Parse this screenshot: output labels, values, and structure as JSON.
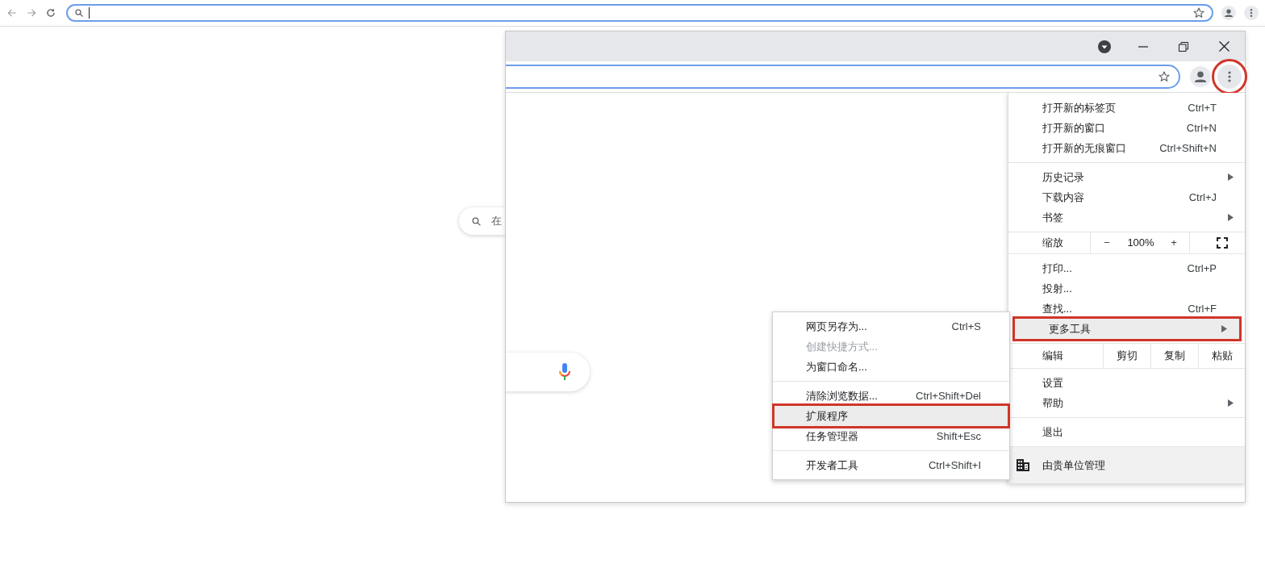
{
  "outer_toolbar": {
    "address_focused": true
  },
  "page_search": {
    "visible_text": "在"
  },
  "inner_window": {
    "menu_button": {
      "highlighted": true
    },
    "menu": {
      "sections": [
        [
          {
            "kind": "item",
            "label": "打开新的标签页",
            "shortcut": "Ctrl+T",
            "highlighted": false
          },
          {
            "kind": "item",
            "label": "打开新的窗口",
            "shortcut": "Ctrl+N",
            "highlighted": false
          },
          {
            "kind": "item",
            "label": "打开新的无痕窗口",
            "shortcut": "Ctrl+Shift+N",
            "highlighted": false
          }
        ],
        [
          {
            "kind": "item",
            "label": "历史记录",
            "has_submenu": true,
            "highlighted": false
          },
          {
            "kind": "item",
            "label": "下载内容",
            "shortcut": "Ctrl+J",
            "highlighted": false
          },
          {
            "kind": "item",
            "label": "书签",
            "has_submenu": true,
            "highlighted": false
          }
        ],
        [
          {
            "kind": "zoom",
            "label": "缩放",
            "minus": "−",
            "value": "100%",
            "plus": "+"
          }
        ],
        [
          {
            "kind": "item",
            "label": "打印...",
            "shortcut": "Ctrl+P",
            "highlighted": false
          },
          {
            "kind": "item",
            "label": "投射...",
            "highlighted": false
          },
          {
            "kind": "item",
            "label": "查找...",
            "shortcut": "Ctrl+F",
            "highlighted": false
          },
          {
            "kind": "item",
            "label": "更多工具",
            "has_submenu": true,
            "highlighted": true
          }
        ],
        [
          {
            "kind": "edit",
            "label": "编辑",
            "buttons": [
              "剪切",
              "复制",
              "粘贴"
            ]
          }
        ],
        [
          {
            "kind": "item",
            "label": "设置",
            "highlighted": false
          },
          {
            "kind": "item",
            "label": "帮助",
            "has_submenu": true,
            "highlighted": false
          }
        ],
        [
          {
            "kind": "item",
            "label": "退出",
            "highlighted": false
          }
        ]
      ],
      "footer": {
        "label": "由贵单位管理"
      }
    },
    "submenu": {
      "sections": [
        [
          {
            "label": "网页另存为...",
            "shortcut": "Ctrl+S",
            "disabled": false,
            "highlighted": false
          },
          {
            "label": "创建快捷方式...",
            "disabled": true,
            "highlighted": false
          },
          {
            "label": "为窗口命名...",
            "disabled": false,
            "highlighted": false
          }
        ],
        [
          {
            "label": "清除浏览数据...",
            "shortcut": "Ctrl+Shift+Del",
            "disabled": false,
            "highlighted": false
          },
          {
            "label": "扩展程序",
            "disabled": false,
            "highlighted": true
          },
          {
            "label": "任务管理器",
            "shortcut": "Shift+Esc",
            "disabled": false,
            "highlighted": false
          }
        ],
        [
          {
            "label": "开发者工具",
            "shortcut": "Ctrl+Shift+I",
            "disabled": false,
            "highlighted": false
          }
        ]
      ]
    }
  }
}
